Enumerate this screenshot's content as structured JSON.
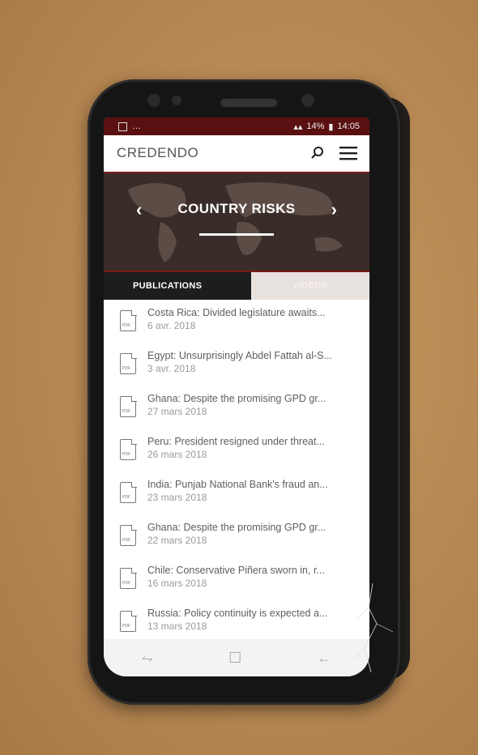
{
  "statusbar": {
    "left": "…",
    "battery": "14%",
    "time": "14:05"
  },
  "app": {
    "logo": "CREDENDO"
  },
  "banner": {
    "title": "COUNTRY RISKS"
  },
  "tabs": [
    {
      "label": "PUBLICATIONS"
    },
    {
      "label": "VIDEOS"
    }
  ],
  "publications": [
    {
      "title": "Costa Rica: Divided legislature awaits...",
      "date": "6 avr. 2018"
    },
    {
      "title": "Egypt: Unsurprisingly Abdel Fattah al-S...",
      "date": "3 avr. 2018"
    },
    {
      "title": "Ghana: Despite the promising GPD gr...",
      "date": "27 mars 2018"
    },
    {
      "title": "Peru: President resigned under threat...",
      "date": "26 mars 2018"
    },
    {
      "title": "India: Punjab National Bank's fraud an...",
      "date": "23 mars 2018"
    },
    {
      "title": "Ghana: Despite the promising GPD gr...",
      "date": "22 mars 2018"
    },
    {
      "title": "Chile: Conservative Piñera sworn in, r...",
      "date": "16 mars 2018"
    },
    {
      "title": "Russia: Policy continuity is expected a...",
      "date": "13 mars 2018"
    }
  ],
  "doc_icon_label": "PDF",
  "icons": [
    "search-icon",
    "menu-icon",
    "chevron-left-icon",
    "chevron-right-icon",
    "pdf-document-icon",
    "back-icon",
    "home-icon",
    "recent-apps-icon"
  ],
  "colors": {
    "accent": "#7c1a14",
    "tab_active": "#1d1d1d",
    "tab_inactive": "#e8e2df"
  }
}
